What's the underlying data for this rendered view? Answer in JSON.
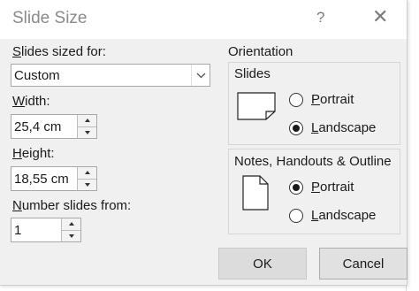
{
  "dialog": {
    "title": "Slide Size",
    "help": "?",
    "close": "✕"
  },
  "slides_sized_for": {
    "label_ul": "S",
    "label_rest": "lides sized for:",
    "value": "Custom"
  },
  "width": {
    "label_ul": "W",
    "label_rest": "idth:",
    "value": "25,4 cm"
  },
  "height": {
    "label_ul": "H",
    "label_rest": "eight:",
    "value": "18,55 cm"
  },
  "number_slides_from": {
    "label_ul": "N",
    "label_rest": "umber slides from:",
    "value": "1"
  },
  "orientation": {
    "label": "Orientation",
    "slides": {
      "label": "Slides",
      "portrait_ul": "P",
      "portrait_rest": "ortrait",
      "landscape_ul": "L",
      "landscape_rest": "andscape",
      "selected": "Landscape"
    },
    "notes": {
      "label": "Notes, Handouts & Outline",
      "portrait_ul": "P",
      "portrait_rest": "ortrait",
      "landscape_ul": "L",
      "landscape_rest": "andscape",
      "selected": "Portrait"
    }
  },
  "footer": {
    "ok": "OK",
    "cancel": "Cancel"
  }
}
